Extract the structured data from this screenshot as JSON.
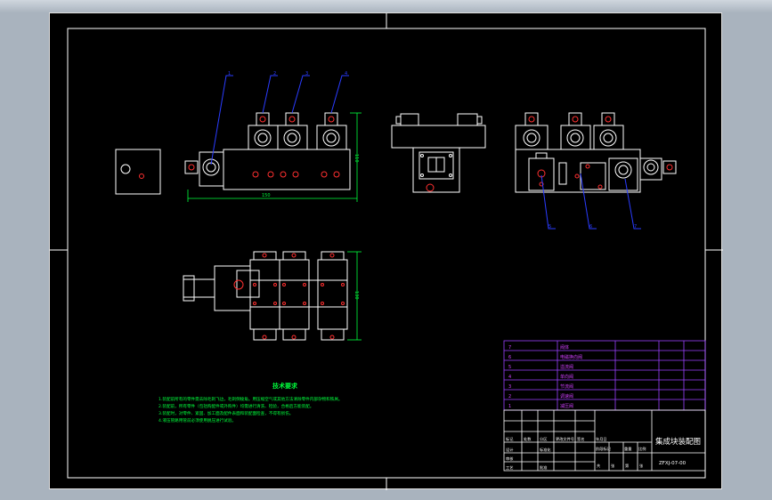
{
  "tech_requirements": {
    "title": "技术要求",
    "items": [
      "1.装配前所有的零件需去除毛刺飞边，毛刺倒棱角。用压缩空气或其他方法清除零件内部杂物和铁屑。",
      "2.装配前，所有零件（包括购配件或外购件）均需进行清洗、检验，合格后方能装配。",
      "3.装配时，对零件、紧固、加工面及配件表面和装配面检查，不得有损伤。",
      "4.液压管路用管前必须使用脱压进行试验。"
    ]
  },
  "title_block": {
    "drawing_name": "集成块装配图",
    "drawing_number": "ZFXJ-07-00",
    "cell_labels": [
      "标记",
      "处数",
      "分区",
      "更改文件号",
      "签名",
      "年月日",
      "设计",
      "标准化",
      "阶段标记",
      "重量",
      "比例",
      "审核",
      "工艺",
      "批准",
      "共",
      "张",
      "第",
      "张"
    ]
  },
  "parts_list": [
    {
      "no": "7",
      "name": "阀体"
    },
    {
      "no": "6",
      "name": "电磁换向阀"
    },
    {
      "no": "5",
      "name": "溢流阀"
    },
    {
      "no": "4",
      "name": "单向阀"
    },
    {
      "no": "3",
      "name": "节流阀"
    },
    {
      "no": "2",
      "name": "调速阀"
    },
    {
      "no": "1",
      "name": "减压阀"
    }
  ],
  "balloons": [
    "1",
    "2",
    "3",
    "4",
    "5",
    "6",
    "7"
  ],
  "dimensions": [
    "110",
    "130",
    "150"
  ],
  "colors": {
    "frame": "#ffffff",
    "part": "#ffffff",
    "leader": "#2a3cff",
    "dimension": "#00ff3c",
    "note": "#00ff3c",
    "hole": "#ff3030",
    "table_text": "#d040ff"
  }
}
